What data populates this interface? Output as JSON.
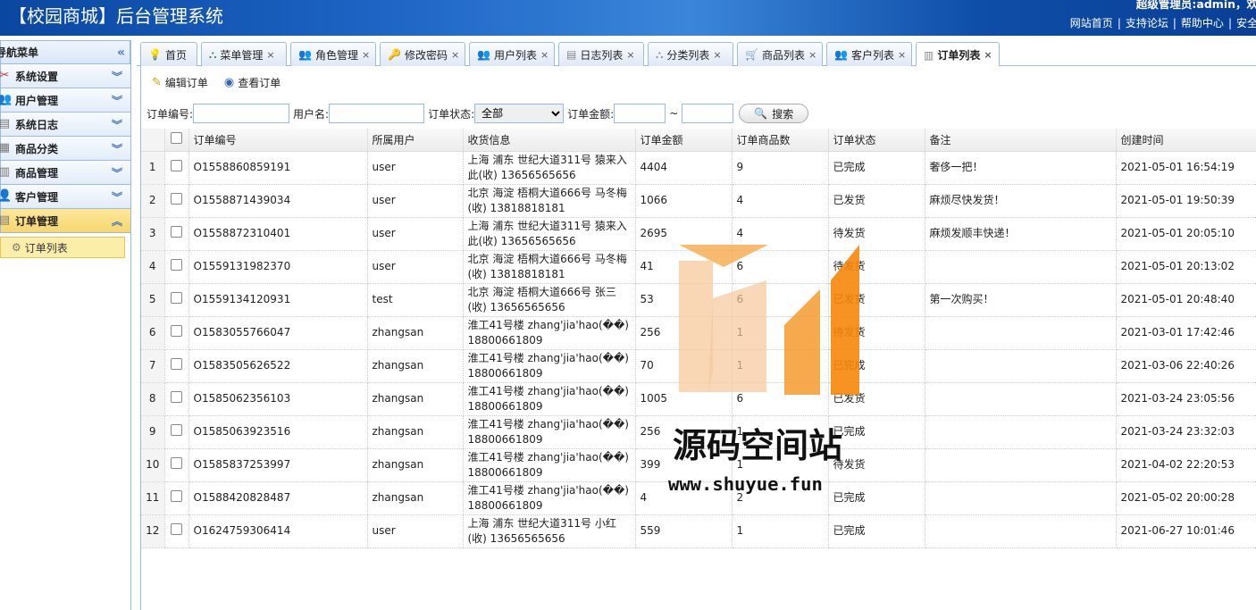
{
  "header": {
    "title": "【校园商城】后台管理系统",
    "user": "超级管理员:admin，欢",
    "links": [
      "网站首页",
      "支持论坛",
      "帮助中心",
      "安全"
    ]
  },
  "sidebar": {
    "title": "导航菜单",
    "items": [
      {
        "label": "系统设置",
        "icon": "tools-icon"
      },
      {
        "label": "用户管理",
        "icon": "users-icon"
      },
      {
        "label": "系统日志",
        "icon": "log-icon"
      },
      {
        "label": "商品分类",
        "icon": "category-icon"
      },
      {
        "label": "商品管理",
        "icon": "goods-icon"
      },
      {
        "label": "客户管理",
        "icon": "customer-icon"
      },
      {
        "label": "订单管理",
        "icon": "order-icon"
      }
    ],
    "sub_item": "订单列表"
  },
  "tabs": [
    "首页",
    "菜单管理",
    "角色管理",
    "修改密码",
    "用户列表",
    "日志列表",
    "分类列表",
    "商品列表",
    "客户列表",
    "订单列表"
  ],
  "toolbar": {
    "edit": "编辑订单",
    "view": "查看订单"
  },
  "search": {
    "order_no_label": "订单编号:",
    "username_label": "用户名:",
    "status_label": "订单状态:",
    "status_value": "全部",
    "amount_label": "订单金额:",
    "tilde": "~",
    "button": "搜索"
  },
  "table": {
    "columns": [
      "订单编号",
      "所属用户",
      "收货信息",
      "订单金额",
      "订单商品数",
      "订单状态",
      "备注",
      "创建时间"
    ],
    "rows": [
      {
        "n": "1",
        "no": "O1558860859191",
        "user": "user",
        "addr": "上海 浦东 世纪大道311号 猿来入此(收) 13656565656",
        "amount": "4404",
        "count": "9",
        "status": "已完成",
        "note": "奢侈一把！",
        "time": "2021-05-01 16:54:19"
      },
      {
        "n": "2",
        "no": "O1558871439034",
        "user": "user",
        "addr": "北京 海淀 梧桐大道666号 马冬梅(收) 13818818181",
        "amount": "1066",
        "count": "4",
        "status": "已发货",
        "note": "麻烦尽快发货！",
        "time": "2021-05-01 19:50:39"
      },
      {
        "n": "3",
        "no": "O1558872310401",
        "user": "user",
        "addr": "上海 浦东 世纪大道311号 猿来入此(收) 13656565656",
        "amount": "2695",
        "count": "4",
        "status": "待发货",
        "note": "麻烦发顺丰快递！",
        "time": "2021-05-01 20:05:10"
      },
      {
        "n": "4",
        "no": "O1559131982370",
        "user": "user",
        "addr": "北京 海淀 梧桐大道666号 马冬梅(收) 13818818181",
        "amount": "41",
        "count": "6",
        "status": "待发货",
        "note": "",
        "time": "2021-05-01 20:13:02"
      },
      {
        "n": "5",
        "no": "O1559134120931",
        "user": "test",
        "addr": "北京 海淀 梧桐大道666号 张三(收) 13656565656",
        "amount": "53",
        "count": "6",
        "status": "已发货",
        "note": "第一次购买！",
        "time": "2021-05-01 20:48:40"
      },
      {
        "n": "6",
        "no": "O1583055766047",
        "user": "zhangsan",
        "addr": "淮工41号楼 zhang'jia'hao(��) 18800661809",
        "amount": "256",
        "count": "1",
        "status": "待发货",
        "note": "",
        "time": "2021-03-01 17:42:46"
      },
      {
        "n": "7",
        "no": "O1583505626522",
        "user": "zhangsan",
        "addr": "淮工41号楼 zhang'jia'hao(��) 18800661809",
        "amount": "70",
        "count": "1",
        "status": "已完成",
        "note": "",
        "time": "2021-03-06 22:40:26"
      },
      {
        "n": "8",
        "no": "O1585062356103",
        "user": "zhangsan",
        "addr": "淮工41号楼 zhang'jia'hao(��) 18800661809",
        "amount": "1005",
        "count": "6",
        "status": "已发货",
        "note": "",
        "time": "2021-03-24 23:05:56"
      },
      {
        "n": "9",
        "no": "O1585063923516",
        "user": "zhangsan",
        "addr": "淮工41号楼 zhang'jia'hao(��) 18800661809",
        "amount": "256",
        "count": "1",
        "status": "已完成",
        "note": "",
        "time": "2021-03-24 23:32:03"
      },
      {
        "n": "10",
        "no": "O1585837253997",
        "user": "zhangsan",
        "addr": "淮工41号楼 zhang'jia'hao(��) 18800661809",
        "amount": "399",
        "count": "1",
        "status": "待发货",
        "note": "",
        "time": "2021-04-02 22:20:53"
      },
      {
        "n": "11",
        "no": "O1588420828487",
        "user": "zhangsan",
        "addr": "淮工41号楼 zhang'jia'hao(��) 18800661809",
        "amount": "4",
        "count": "2",
        "status": "已完成",
        "note": "",
        "time": "2021-05-02 20:00:28"
      },
      {
        "n": "12",
        "no": "O1624759306414",
        "user": "user",
        "addr": "上海 浦东 世纪大道311号 小红(收) 13656565656",
        "amount": "559",
        "count": "1",
        "status": "已完成",
        "note": "",
        "time": "2021-06-27 10:01:46"
      }
    ]
  },
  "watermark": {
    "name": "源码空间站",
    "url": "www.shuyue.fun"
  }
}
